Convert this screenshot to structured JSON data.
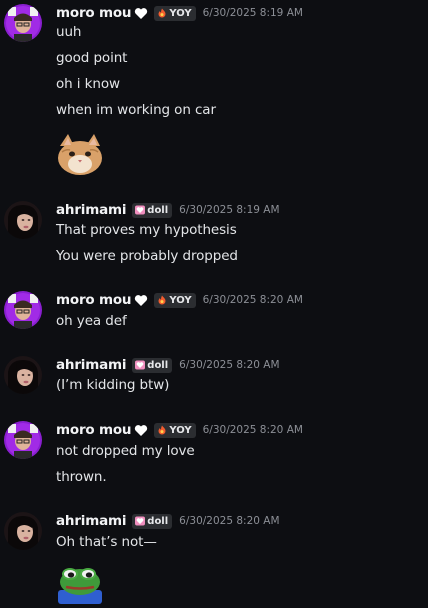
{
  "messages": [
    {
      "author": "moro mou",
      "tag": "YOY",
      "tag_icon": "fire-icon",
      "timestamp": "6/30/2025 8:19 AM",
      "lines": [
        "uuh",
        "good point",
        "oh i know",
        "when im working on car"
      ],
      "attachment": "cat-emoji"
    },
    {
      "author": "ahrimami",
      "tag": "doll",
      "tag_icon": "pink-heart-icon",
      "timestamp": "6/30/2025 8:19 AM",
      "lines": [
        "That proves my hypothesis",
        "You were probably dropped"
      ]
    },
    {
      "author": "moro mou",
      "tag": "YOY",
      "tag_icon": "fire-icon",
      "timestamp": "6/30/2025 8:20 AM",
      "lines": [
        "oh yea def"
      ]
    },
    {
      "author": "ahrimami",
      "tag": "doll",
      "tag_icon": "pink-heart-icon",
      "timestamp": "6/30/2025 8:20 AM",
      "lines": [
        "(I’m kidding btw)"
      ]
    },
    {
      "author": "moro mou",
      "tag": "YOY",
      "tag_icon": "fire-icon",
      "timestamp": "6/30/2025 8:20 AM",
      "lines": [
        "not dropped my love",
        "thrown."
      ]
    },
    {
      "author": "ahrimami",
      "tag": "doll",
      "tag_icon": "pink-heart-icon",
      "timestamp": "6/30/2025 8:20 AM",
      "lines": [
        "Oh that’s not—"
      ],
      "attachment": "pepe-frog-emoji"
    }
  ],
  "colors": {
    "background": "#0d0e12",
    "username": "#f2f3f5",
    "timestamp": "#8c8f96",
    "tag_bg": "#2b2d31"
  }
}
